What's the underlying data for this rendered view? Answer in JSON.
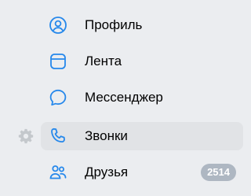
{
  "colors": {
    "icon_accent": "#2688eb",
    "active_bg": "#e1e3e6",
    "badge_bg": "#aeb7c2",
    "gear": "#c4c8cc"
  },
  "menu": {
    "items": [
      {
        "label": "Профиль",
        "icon": "profile-icon",
        "active": false
      },
      {
        "label": "Лента",
        "icon": "feed-icon",
        "active": false
      },
      {
        "label": "Мессенджер",
        "icon": "messenger-icon",
        "active": false
      },
      {
        "label": "Звонки",
        "icon": "phone-icon",
        "active": true
      },
      {
        "label": "Друзья",
        "icon": "friends-icon",
        "active": false,
        "badge": "2514"
      }
    ]
  },
  "settings": {
    "icon": "gear-icon"
  }
}
